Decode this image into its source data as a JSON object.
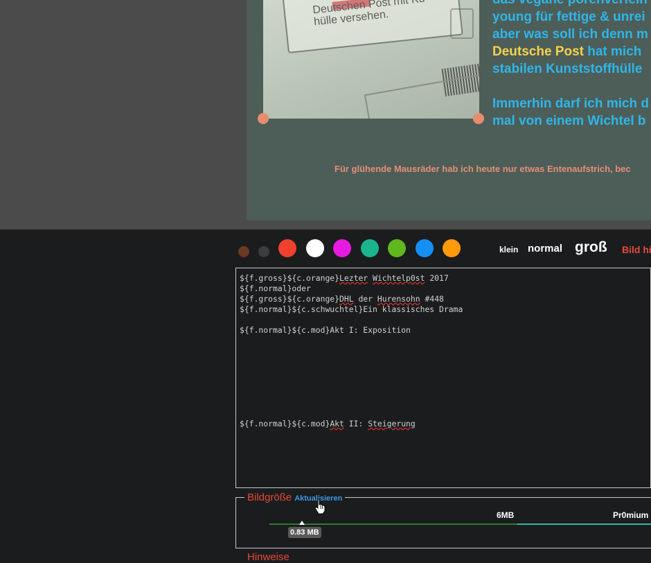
{
  "preview": {
    "photo_text": [
      "Deutschen Post mit Ku",
      "hülle versehen."
    ],
    "story_lines": [
      {
        "text": "das vegane porenverfein"
      },
      {
        "text": "young für fettige & unrei"
      },
      {
        "text": "aber was soll ich denn m"
      },
      {
        "highlight": "Deutsche Post",
        "text": " hat mich"
      },
      {
        "text": "stabilen Kunststoffhülle"
      },
      {
        "text": ""
      },
      {
        "text": "Immerhin darf ich mich d"
      },
      {
        "text": "mal von einem Wichtel b"
      }
    ],
    "footer": "Für glühende Mausräder hab ich heute nur etwas Entenaufstrich, bec"
  },
  "toolbar": {
    "colors": [
      "#6b3a22",
      "#3c3c3e",
      "#f0412e",
      "#ffffff",
      "#e61ae0",
      "#1ab58e",
      "#5fb81d",
      "#1490f5",
      "#ff9a0a"
    ],
    "sizes": {
      "small": "klein",
      "normal": "normal",
      "large": "groß"
    },
    "image_link": "Bild hi"
  },
  "editor": {
    "lines": [
      "${f.gross}${c.orange}Lezter Wichtelp0st 2017",
      "${f.normal}oder",
      "${f.gross}${c.orange}DHL der Hurensohn #448",
      "${f.normal}${c.schwuchtel}Ein klassisches Drama",
      "",
      "${f.normal}${c.mod}Akt I: Exposition",
      "",
      "",
      "",
      "",
      "",
      "",
      "",
      "",
      "${f.normal}${c.mod}Akt II: Steigerung"
    ]
  },
  "image_size": {
    "legend": "Bildgröße",
    "update": "Aktualisieren",
    "limit_label": "6MB",
    "premium_label": "Pr0mium",
    "current": "0.83 MB",
    "current_mb": 0.83
  },
  "next_section": "Hinweise",
  "icons": {
    "cursor": "hand-pointer-icon"
  }
}
